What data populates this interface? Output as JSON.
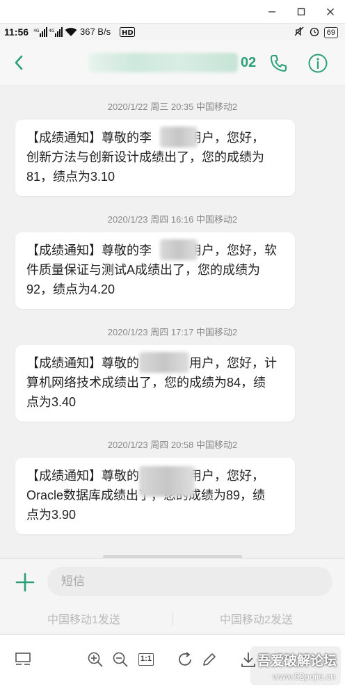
{
  "window": {
    "controls": [
      "minimize-icon",
      "maximize-icon",
      "close-icon"
    ]
  },
  "status_bar": {
    "time": "11:56",
    "net_speed": "367 B/s",
    "battery": "69",
    "icons": [
      "signal-icon",
      "signal-icon",
      "wifi-icon",
      "hd-icon",
      "mute-icon",
      "alarm-icon",
      "battery-icon"
    ]
  },
  "app_bar": {
    "contact_tail": "02",
    "accent_color": "#2a9f78"
  },
  "messages": [
    {
      "timestamp": "2020/1/22 周三 20:35  中国移动2",
      "line1_prefix": "【成绩通知】尊敬的李",
      "line1_suffix": "用户，您好，",
      "line2": "创新方法与创新设计成绩出了，您的成绩为",
      "line3": "81，绩点为3.10"
    },
    {
      "timestamp": "2020/1/23 周四 16:16  中国移动2",
      "line1_prefix": "【成绩通知】尊敬的李",
      "line1_suffix": "用户，您好，软",
      "line2": "件质量保证与测试A成绩出了，您的成绩为",
      "line3": "92，绩点为4.20"
    },
    {
      "timestamp": "2020/1/23 周四 17:17  中国移动2",
      "line1_prefix": "【成绩通知】尊敬的",
      "line1_suffix": "用户，您好，计",
      "line2": "算机网络技术成绩出了，您的成绩为84，绩",
      "line3": "点为3.40"
    },
    {
      "timestamp": "2020/1/23 周四 20:58  中国移动2",
      "line1_prefix": "【成绩通知】尊敬的",
      "line1_suffix": "用户，您好，",
      "line2": "Oracle数据库成绩出了，您的成绩为89，绩",
      "line3": "点为3.90"
    }
  ],
  "composer": {
    "placeholder": "短信",
    "send_sim1": "中国移动1发送",
    "send_sim2": "中国移动2发送"
  },
  "viewer_toolbar": {
    "ratio_label": "1:1",
    "watermark_text": "吾爱破解论坛",
    "watermark_url": "www.52pojie.cn"
  }
}
